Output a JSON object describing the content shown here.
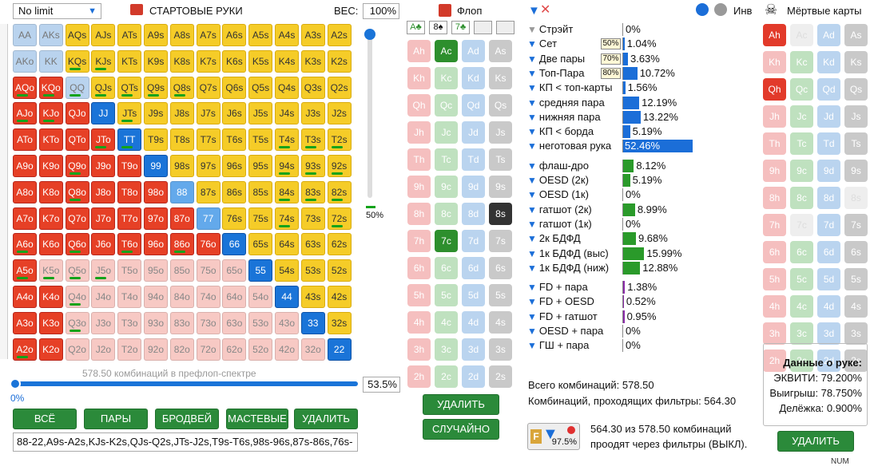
{
  "top": {
    "limit": "No limit",
    "hands_title": "СТАРТОВЫЕ РУКИ",
    "weight_label": "ВЕС:",
    "weight_value": "100%",
    "flop_title": "Флоп",
    "inv_label": "Инв",
    "dead_title": "Мёртвые карты"
  },
  "grid": {
    "rows": [
      [
        "AA",
        "AKs",
        "AQs",
        "AJs",
        "ATs",
        "A9s",
        "A8s",
        "A7s",
        "A6s",
        "A5s",
        "A4s",
        "A3s",
        "A2s"
      ],
      [
        "AKo",
        "KK",
        "KQs",
        "KJs",
        "KTs",
        "K9s",
        "K8s",
        "K7s",
        "K6s",
        "K5s",
        "K4s",
        "K3s",
        "K2s"
      ],
      [
        "AQo",
        "KQo",
        "QQ",
        "QJs",
        "QTs",
        "Q9s",
        "Q8s",
        "Q7s",
        "Q6s",
        "Q5s",
        "Q4s",
        "Q3s",
        "Q2s"
      ],
      [
        "AJo",
        "KJo",
        "QJo",
        "JJ",
        "JTs",
        "J9s",
        "J8s",
        "J7s",
        "J6s",
        "J5s",
        "J4s",
        "J3s",
        "J2s"
      ],
      [
        "ATo",
        "KTo",
        "QTo",
        "JTo",
        "TT",
        "T9s",
        "T8s",
        "T7s",
        "T6s",
        "T5s",
        "T4s",
        "T3s",
        "T2s"
      ],
      [
        "A9o",
        "K9o",
        "Q9o",
        "J9o",
        "T9o",
        "99",
        "98s",
        "97s",
        "96s",
        "95s",
        "94s",
        "93s",
        "92s"
      ],
      [
        "A8o",
        "K8o",
        "Q8o",
        "J8o",
        "T8o",
        "98o",
        "88",
        "87s",
        "86s",
        "85s",
        "84s",
        "83s",
        "82s"
      ],
      [
        "A7o",
        "K7o",
        "Q7o",
        "J7o",
        "T7o",
        "97o",
        "87o",
        "77",
        "76s",
        "75s",
        "74s",
        "73s",
        "72s"
      ],
      [
        "A6o",
        "K6o",
        "Q6o",
        "J6o",
        "T6o",
        "96o",
        "86o",
        "76o",
        "66",
        "65s",
        "64s",
        "63s",
        "62s"
      ],
      [
        "A5o",
        "K5o",
        "Q5o",
        "J5o",
        "T5o",
        "95o",
        "85o",
        "75o",
        "65o",
        "55",
        "54s",
        "53s",
        "52s"
      ],
      [
        "A4o",
        "K4o",
        "Q4o",
        "J4o",
        "T4o",
        "94o",
        "84o",
        "74o",
        "64o",
        "54o",
        "44",
        "43s",
        "42s"
      ],
      [
        "A3o",
        "K3o",
        "Q3o",
        "J3o",
        "T3o",
        "93o",
        "83o",
        "73o",
        "63o",
        "53o",
        "43o",
        "33",
        "32s"
      ],
      [
        "A2o",
        "K2o",
        "Q2o",
        "J2o",
        "T2o",
        "92o",
        "82o",
        "72o",
        "62o",
        "52o",
        "42o",
        "32o",
        "22"
      ]
    ],
    "styles": [
      "bbyyyyyyyyyyy",
      "bbyyyyyyyyyyy",
      "rrbyyyyyyyyyy",
      "rrrByyyyyyyyy",
      "rrrrByyyyyyyy",
      "rrrrrByyyyyyy",
      "rrrrrrMyyyyyy",
      "rrrrrrrMyyyyy",
      "rrrrrrrrByyyy",
      "rLLLLLLLLByyy",
      "rrLLLLLLLLByy",
      "rrLLLLLLLLLBy",
      "rrLLLLLLLLLLB"
    ],
    "greens": [
      "",
      "  gg",
      "ggggggg",
      "gg  g",
      "   gg     ggg",
      "  g       ggg",
      "  g       ggg",
      "          g g",
      "g g g g      ",
      "gggg          ",
      "  g          ",
      "  g          ",
      "g            "
    ]
  },
  "range_bar": {
    "combos": "578.50 комбинаций в префлоп-спектре",
    "pct": "53.5%",
    "zero": "0%",
    "slider_pct": "50%"
  },
  "buttons": {
    "all": "ВСЁ",
    "pairs": "ПАРЫ",
    "broadway": "БРОДВЕЙ",
    "suited": "МАСТЕВЫЕ",
    "delete": "УДАЛИТЬ",
    "flop_delete": "УДАЛИТЬ",
    "random": "СЛУЧАЙНО",
    "dead_delete": "УДАЛИТЬ"
  },
  "range_text": "88-22,A9s-A2s,KJs-K2s,QJs-Q2s,JTs-J2s,T9s-T6s,98s-96s,87s-86s,76s-",
  "flop": {
    "board": [
      "A♣",
      "8♠",
      "7♣",
      "",
      ""
    ],
    "cols": [
      "h",
      "c",
      "d",
      "s"
    ],
    "ranks": [
      "A",
      "K",
      "Q",
      "J",
      "T",
      "9",
      "8",
      "7",
      "6",
      "5",
      "4",
      "3",
      "2"
    ],
    "selected": [
      "Ac",
      "8s",
      "7c"
    ]
  },
  "dead": {
    "selected": [
      "Ah",
      "Qh"
    ],
    "faded": [
      "Ac",
      "8s",
      "7c"
    ]
  },
  "stats": [
    {
      "name": "Стрэйт",
      "value": "0%",
      "pct": 0,
      "color": "#1b6ed8",
      "filter": false
    },
    {
      "name": "Сет",
      "value": "1.04%",
      "pct": 1.04,
      "color": "#1b6ed8",
      "badge": "50%"
    },
    {
      "name": "Две пары",
      "value": "3.63%",
      "pct": 3.63,
      "color": "#1b6ed8",
      "badge": "70%"
    },
    {
      "name": "Топ-Пара",
      "value": "10.72%",
      "pct": 10.72,
      "color": "#1b6ed8",
      "badge": "80%"
    },
    {
      "name": "КП < топ-карты",
      "value": "1.56%",
      "pct": 1.56,
      "color": "#1b6ed8"
    },
    {
      "name": "средняя пара",
      "value": "12.19%",
      "pct": 12.19,
      "color": "#1b6ed8"
    },
    {
      "name": "нижняя пара",
      "value": "13.22%",
      "pct": 13.22,
      "color": "#1b6ed8"
    },
    {
      "name": "КП < борда",
      "value": "5.19%",
      "pct": 5.19,
      "color": "#1b6ed8"
    },
    {
      "name": "неготовая рука",
      "value": "52.46%",
      "pct": 52.46,
      "color": "#1b6ed8"
    },
    {
      "name": "флаш-дро",
      "value": "8.12%",
      "pct": 8.12,
      "color": "#2a9a2a"
    },
    {
      "name": "OESD (2к)",
      "value": "5.19%",
      "pct": 5.19,
      "color": "#2a9a2a"
    },
    {
      "name": "OESD (1к)",
      "value": "0%",
      "pct": 0,
      "color": "#2a9a2a"
    },
    {
      "name": "гатшот (2к)",
      "value": "8.99%",
      "pct": 8.99,
      "color": "#2a9a2a"
    },
    {
      "name": "гатшот (1к)",
      "value": "0%",
      "pct": 0,
      "color": "#2a9a2a"
    },
    {
      "name": "2к БДФД",
      "value": "9.68%",
      "pct": 9.68,
      "color": "#2a9a2a"
    },
    {
      "name": "1к БДФД (выс)",
      "value": "15.99%",
      "pct": 15.99,
      "color": "#2a9a2a"
    },
    {
      "name": "1к БДФД (ниж)",
      "value": "12.88%",
      "pct": 12.88,
      "color": "#2a9a2a"
    },
    {
      "name": "FD + пара",
      "value": "1.38%",
      "pct": 1.38,
      "color": "#8a2aa8"
    },
    {
      "name": "FD + OESD",
      "value": "0.52%",
      "pct": 0.52,
      "color": "#8a2aa8"
    },
    {
      "name": "FD + гатшот",
      "value": "0.95%",
      "pct": 0.95,
      "color": "#8a2aa8"
    },
    {
      "name": "OESD + пара",
      "value": "0%",
      "pct": 0,
      "color": "#8a2aa8"
    },
    {
      "name": "ГШ + пара",
      "value": "0%",
      "pct": 0,
      "color": "#8a2aa8"
    }
  ],
  "totals": {
    "all": "Всего комбинаций: 578.50",
    "passing": "Комбинаций, проходящих фильтры: 564.30",
    "filter_pct": "97.5%",
    "summary1": "564.30 из 578.50 комбинаций",
    "summary2": "проодят через фильтры (ВЫКЛ)."
  },
  "hand_info": {
    "title": "Данные о руке:",
    "equity": "ЭКВИТИ: 79.200%",
    "win": "Выигрыш: 78.750%",
    "tie": "Делёжка: 0.900%"
  },
  "status": "NUM"
}
